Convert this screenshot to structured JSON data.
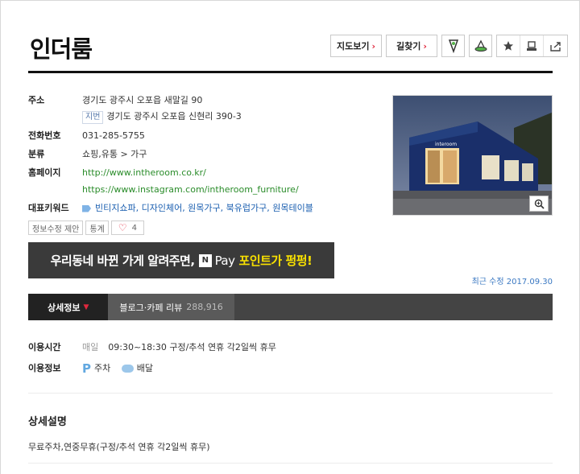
{
  "place": {
    "title": "인더룸"
  },
  "toolbar": {
    "directions_map": "지도보기",
    "directions_route": "길찾기",
    "arrow": "›"
  },
  "info": {
    "address_label": "주소",
    "address": "경기도 광주시 오포읍 새말길 90",
    "jibun_badge": "지번",
    "jibun_address": "경기도 광주시 오포읍 신현리 390-3",
    "phone_label": "전화번호",
    "phone": "031-285-5755",
    "category_label": "분류",
    "category": "쇼핑,유통 > 가구",
    "homepage_label": "홈페이지",
    "homepage_1": "http://www.intheroom.co.kr/",
    "homepage_2": "https://www.instagram.com/intheroom_furniture/",
    "keywords_label": "대표키워드",
    "keywords": "빈티지쇼파, 디자인체어, 원목가구, 북유럽가구, 원목테이블"
  },
  "actions": {
    "suggest_edit": "정보수정 제안",
    "stats": "통계",
    "like_count": "4"
  },
  "banner": {
    "text_before": "우리동네 바뀐 가게 알려주면,",
    "npay_logo": "N",
    "npay_text": "Pay",
    "text_highlight": "포인트가 펑펑!"
  },
  "updated": "최근 수정 2017.09.30",
  "tabs": [
    {
      "label": "상세정보",
      "count": ""
    },
    {
      "label": "블로그·카페 리뷰",
      "count": "288,916"
    }
  ],
  "usage": {
    "hours_label": "이용시간",
    "hours_day": "매일",
    "hours_value": "09:30~18:30 구정/추석 연휴 각2일씩 휴무",
    "info_label": "이용정보",
    "parking_icon_char": "P",
    "parking": "주차",
    "delivery": "배달"
  },
  "description": {
    "title": "상세설명",
    "text": "무료주차,연중무휴(구정/추석 연휴 각2일씩 휴무)"
  },
  "colors": {
    "accent_red": "#e0283d",
    "link_green": "#2a8c2a",
    "keyword_blue": "#1b5fb0",
    "banner_yellow": "#f8e000"
  }
}
